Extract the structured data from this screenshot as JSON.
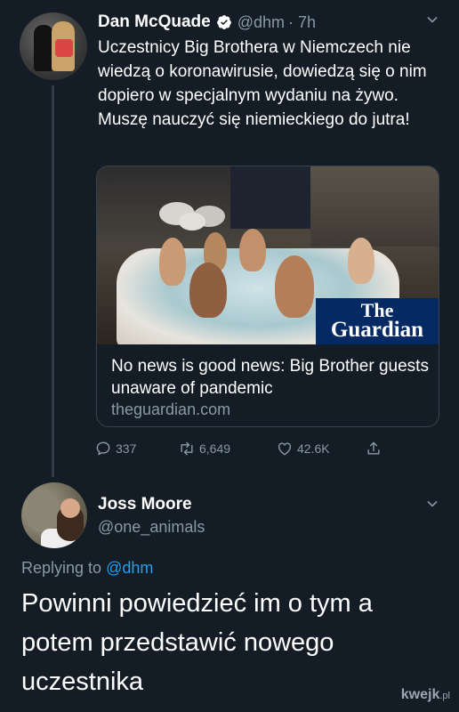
{
  "tweet": {
    "author_name": "Dan McQuade",
    "handle": "@dhm",
    "time": "· 7h",
    "text": "Uczestnicy Big Brothera w Niemczech nie wiedzą o koronawirusie, dowiedzą się o nim dopiero w specjalnym wydaniu na żywo. Muszę nauczyć się niemieckiego do jutra!",
    "card": {
      "logo_line1": "The",
      "logo_line2": "Guardian",
      "title": "No news is good news: Big Brother guests unaware of pandemic",
      "domain": "theguardian.com"
    },
    "actions": {
      "replies": "337",
      "retweets": "6,649",
      "likes": "42.6K"
    }
  },
  "reply": {
    "author_name": "Joss Moore",
    "handle": "@one_animals",
    "replying_to_label": "Replying to",
    "replying_to_handle": "@dhm",
    "text": "Powinni powiedzieć im o tym a potem przedstawić nowego uczestnika"
  },
  "watermark": {
    "brand": "kwejk",
    "suffix": ".pl"
  },
  "colors": {
    "background": "#141d26",
    "secondary_text": "#8899a6",
    "link": "#1da1f2",
    "verified": "#1da1f2",
    "guardian_blue": "#052962"
  },
  "icons": [
    "verified-badge-icon",
    "chevron-down-icon",
    "reply-icon",
    "retweet-icon",
    "like-icon",
    "share-icon"
  ]
}
